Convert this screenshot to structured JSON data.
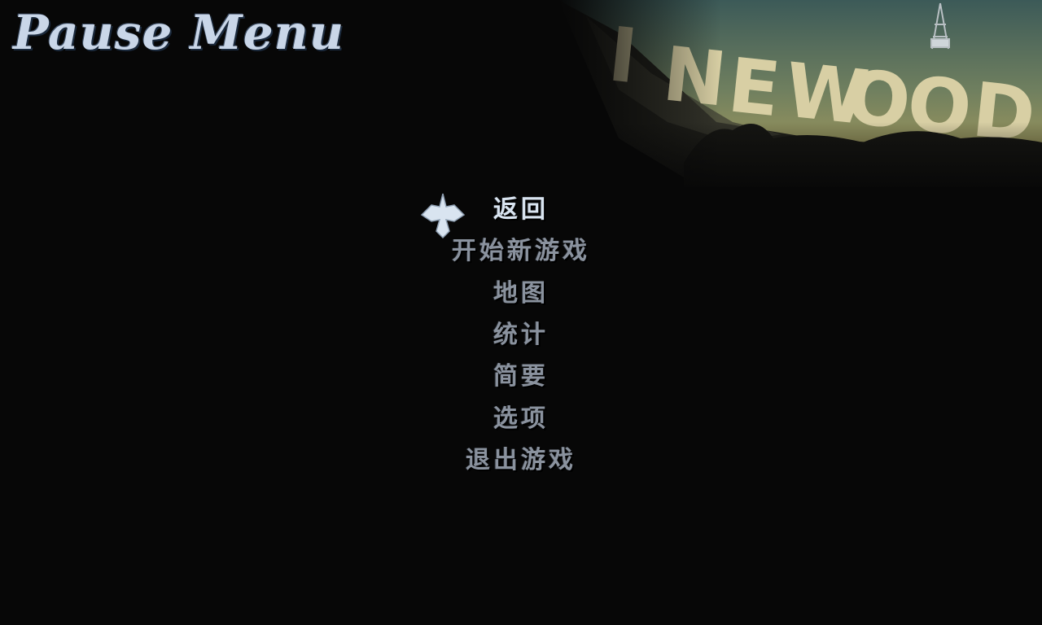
{
  "title": "Pause Menu",
  "sign_text": "INEWOOD",
  "menu": {
    "selected_index": 0,
    "items": [
      {
        "label": "返回"
      },
      {
        "label": "开始新游戏"
      },
      {
        "label": "地图"
      },
      {
        "label": "统计"
      },
      {
        "label": "简要"
      },
      {
        "label": "选项"
      },
      {
        "label": "退出游戏"
      }
    ]
  },
  "colors": {
    "background": "#070707",
    "title": "#c9d6e8",
    "menu_item": "#8a929e",
    "menu_item_selected": "#d9e4f0",
    "sign": "#d8cfa4",
    "sky": "#4a6a62"
  },
  "icons": {
    "cursor": "fleur-cross-icon"
  }
}
